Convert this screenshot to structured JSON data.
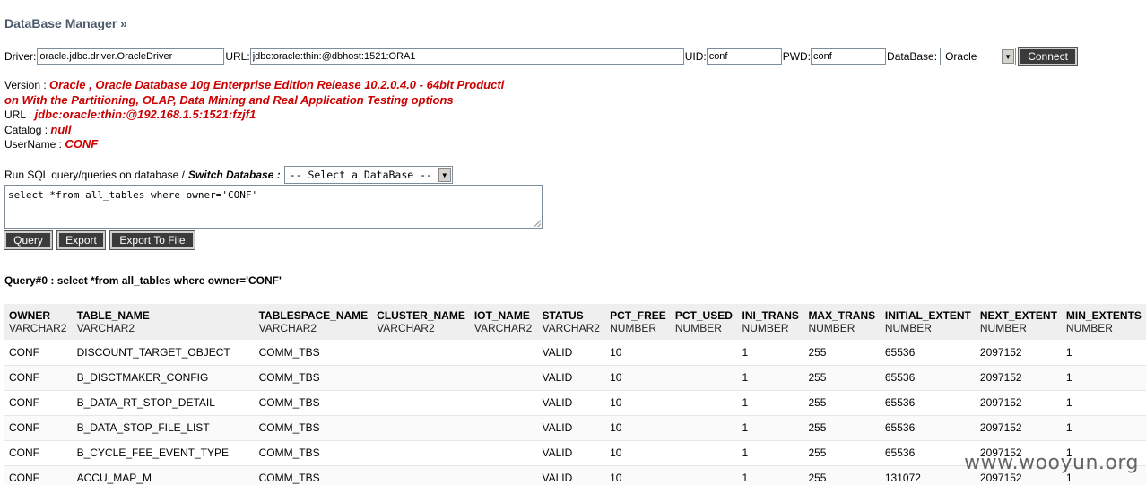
{
  "app": {
    "title": "DataBase Manager »"
  },
  "connection": {
    "driver_label": "Driver:",
    "driver_value": "oracle.jdbc.driver.OracleDriver",
    "url_label": "URL:",
    "url_value": "jdbc:oracle:thin:@dbhost:1521:ORA1",
    "uid_label": "UID:",
    "uid_value": "conf",
    "pwd_label": "PWD:",
    "pwd_value": "conf",
    "database_label": "DataBase:",
    "database_selected": "Oracle",
    "connect_label": "Connect"
  },
  "info": {
    "version_label": "Version :",
    "version_value_line1": "Oracle , Oracle Database 10g Enterprise Edition Release 10.2.0.4.0 - 64bit Producti",
    "version_value_line2": "on With the Partitioning, OLAP, Data Mining and Real Application Testing options",
    "url_label": "URL :",
    "url_value": "jdbc:oracle:thin:@192.168.1.5:1521:fzjf1",
    "catalog_label": "Catalog :",
    "catalog_value": "null",
    "username_label": "UserName :",
    "username_value": "CONF"
  },
  "sql": {
    "run_label": "Run SQL query/queries on database /",
    "switch_label": "Switch Database :",
    "switch_selected": "-- Select a DataBase --",
    "query_text": "select *from all_tables where owner='CONF'",
    "query_button": "Query",
    "export_button": "Export",
    "export_file_button": "Export To File"
  },
  "result": {
    "label": "Query#0 : select *from all_tables where owner='CONF'",
    "columns": [
      {
        "name": "OWNER",
        "type": "VARCHAR2"
      },
      {
        "name": "TABLE_NAME",
        "type": "VARCHAR2"
      },
      {
        "name": "TABLESPACE_NAME",
        "type": "VARCHAR2"
      },
      {
        "name": "CLUSTER_NAME",
        "type": "VARCHAR2"
      },
      {
        "name": "IOT_NAME",
        "type": "VARCHAR2"
      },
      {
        "name": "STATUS",
        "type": "VARCHAR2"
      },
      {
        "name": "PCT_FREE",
        "type": "NUMBER"
      },
      {
        "name": "PCT_USED",
        "type": "NUMBER"
      },
      {
        "name": "INI_TRANS",
        "type": "NUMBER"
      },
      {
        "name": "MAX_TRANS",
        "type": "NUMBER"
      },
      {
        "name": "INITIAL_EXTENT",
        "type": "NUMBER"
      },
      {
        "name": "NEXT_EXTENT",
        "type": "NUMBER"
      },
      {
        "name": "MIN_EXTENTS",
        "type": "NUMBER"
      }
    ],
    "rows": [
      [
        "CONF",
        "DISCOUNT_TARGET_OBJECT",
        "COMM_TBS",
        "",
        "",
        "VALID",
        "10",
        "",
        "1",
        "255",
        "65536",
        "2097152",
        "1"
      ],
      [
        "CONF",
        "B_DISCTMAKER_CONFIG",
        "COMM_TBS",
        "",
        "",
        "VALID",
        "10",
        "",
        "1",
        "255",
        "65536",
        "2097152",
        "1"
      ],
      [
        "CONF",
        "B_DATA_RT_STOP_DETAIL",
        "COMM_TBS",
        "",
        "",
        "VALID",
        "10",
        "",
        "1",
        "255",
        "65536",
        "2097152",
        "1"
      ],
      [
        "CONF",
        "B_DATA_STOP_FILE_LIST",
        "COMM_TBS",
        "",
        "",
        "VALID",
        "10",
        "",
        "1",
        "255",
        "65536",
        "2097152",
        "1"
      ],
      [
        "CONF",
        "B_CYCLE_FEE_EVENT_TYPE",
        "COMM_TBS",
        "",
        "",
        "VALID",
        "10",
        "",
        "1",
        "255",
        "65536",
        "2097152",
        "1"
      ],
      [
        "CONF",
        "ACCU_MAP_M",
        "COMM_TBS",
        "",
        "",
        "VALID",
        "10",
        "",
        "1",
        "255",
        "131072",
        "2097152",
        "1"
      ]
    ]
  },
  "watermark": "www.wooyun.org"
}
